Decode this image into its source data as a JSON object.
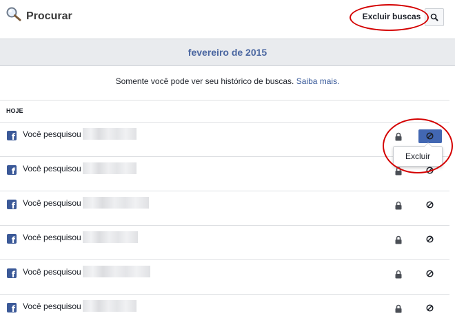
{
  "header": {
    "title": "Procurar",
    "clear_label": "Excluir buscas",
    "search_icon": "search-icon"
  },
  "month": "fevereiro de 2015",
  "privacy": {
    "text": "Somente você pode ver seu histórico de buscas.",
    "link": "Saiba mais."
  },
  "section_label": "HOJE",
  "rows": [
    {
      "prefix": "Você pesquisou",
      "redacted": true
    },
    {
      "prefix": "Você pesquisou",
      "redacted": true
    },
    {
      "prefix": "Você pesquisou",
      "redacted": true
    },
    {
      "prefix": "Você pesquisou",
      "redacted": true
    },
    {
      "prefix": "Você pesquisou",
      "redacted": true
    },
    {
      "prefix": "Você pesquisou",
      "redacted": true
    }
  ],
  "tooltip": "Excluir",
  "colors": {
    "accent": "#4267b2",
    "facebook": "#3b5998",
    "link": "#365899",
    "annotation": "#d40000"
  }
}
